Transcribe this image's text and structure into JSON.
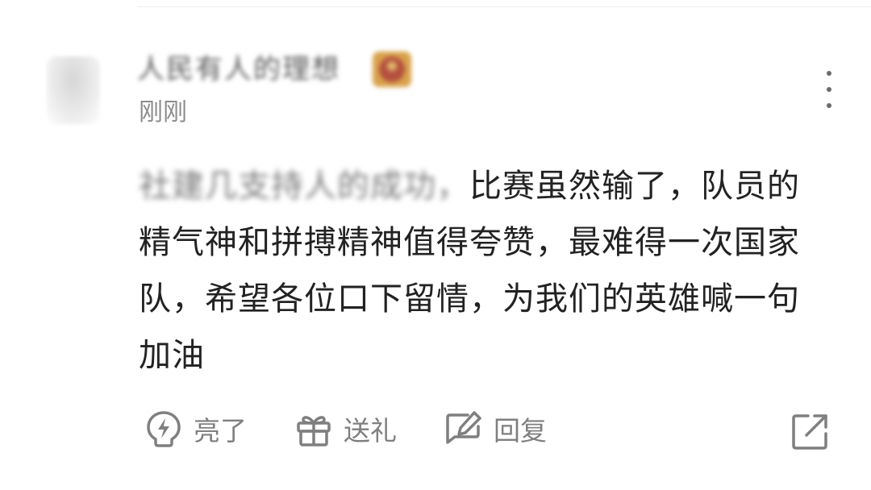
{
  "comment": {
    "author": {
      "name": "人民有人的理想",
      "badge_colors": [
        "#b4503f",
        "#d8a24b"
      ]
    },
    "timestamp": "刚刚",
    "mention": "社建几支持人的成功，",
    "text": "比赛虽然输了，队员的精气神和拼搏精神值得夸赞，最难得一次国家队，希望各位口下留情，为我们的英雄喊一句加油"
  },
  "actions": {
    "like_label": "亮了",
    "gift_label": "送礼",
    "reply_label": "回复"
  },
  "icons": {
    "like": "lightning-icon",
    "gift": "gift-icon",
    "reply": "edit-icon",
    "share": "share-icon",
    "more": "more-vertical-icon"
  },
  "colors": {
    "text": "#222222",
    "secondary_text": "#8c8c8c",
    "icon": "#7f7f7f"
  }
}
